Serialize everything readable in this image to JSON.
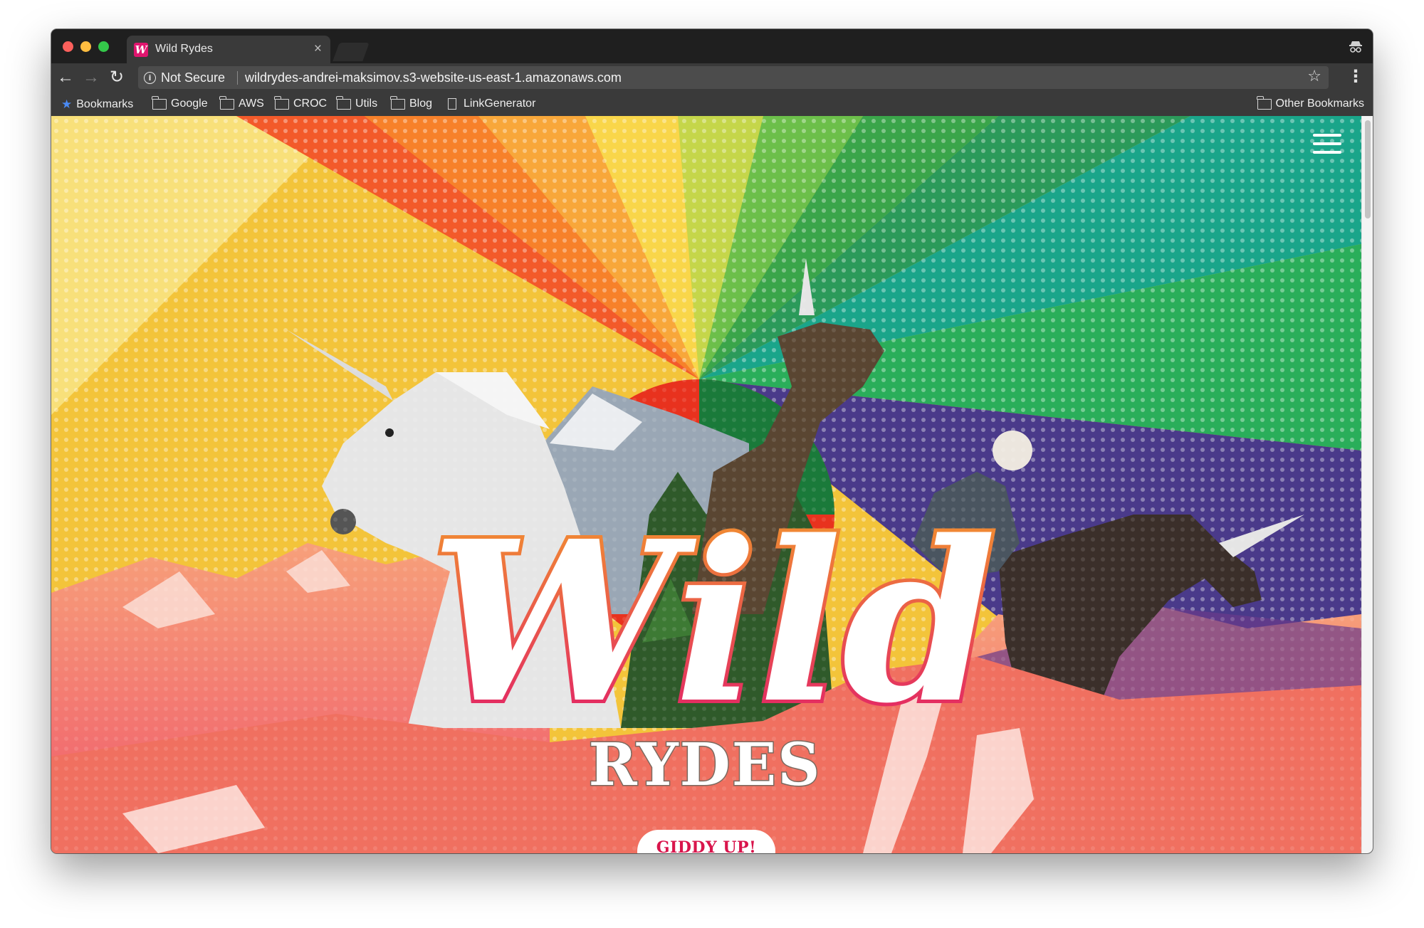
{
  "window": {
    "tab": {
      "title": "Wild Rydes",
      "favicon": "W",
      "close": "×"
    },
    "incognito_icon": "incognito-icon"
  },
  "toolbar": {
    "back": "←",
    "forward": "→",
    "reload": "↻",
    "security_label": "Not Secure",
    "url": "wildrydes-andrei-maksimov.s3-website-us-east-1.amazonaws.com",
    "star": "☆",
    "menu": "⋮"
  },
  "bookmarks": {
    "items": [
      "Bookmarks",
      "Google",
      "AWS",
      "CROC",
      "Utils",
      "Blog",
      "LinkGenerator"
    ],
    "other": "Other Bookmarks"
  },
  "page": {
    "logo_top": "Wild",
    "logo_bottom": "RYDES",
    "cta_label": "GIDDY UP!",
    "menu_icon": "hamburger-menu-icon"
  },
  "colors": {
    "chrome_dark": "#1f1f1f",
    "chrome_toolbar": "#3a3a3a",
    "logo_pink": "#e0156e",
    "logo_orange": "#f07a1e",
    "mountain_orange": "#f47a4e"
  }
}
